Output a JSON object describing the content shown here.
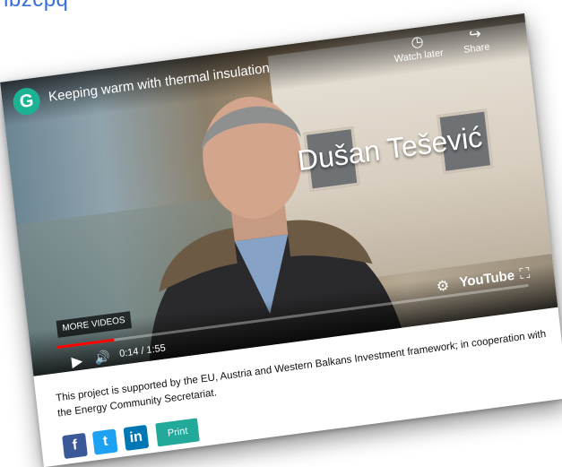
{
  "page": {
    "top_link": "nbzcpq"
  },
  "video": {
    "title": "Keeping warm with thermal insulation",
    "watch_later": "Watch later",
    "share": "Share",
    "caption_name": "Dušan Tešević",
    "more_videos": "MORE VIDEOS",
    "time": "0:14 / 1:55",
    "progress": 0.12,
    "youtube": "YouTube",
    "colors": {
      "progress": "#ff0000",
      "logo": "#1cb394"
    }
  },
  "description": "This project is supported by the EU, Austria and Western Balkans Investment framework; in cooperation with the Energy Community Secretariat.",
  "share": {
    "facebook": "f",
    "twitter": "t",
    "linkedin": "in",
    "print_label": "Print",
    "colors": {
      "facebook": "#3b5998",
      "twitter": "#1da1f2",
      "linkedin": "#0077b5",
      "print": "#22a99a"
    }
  }
}
